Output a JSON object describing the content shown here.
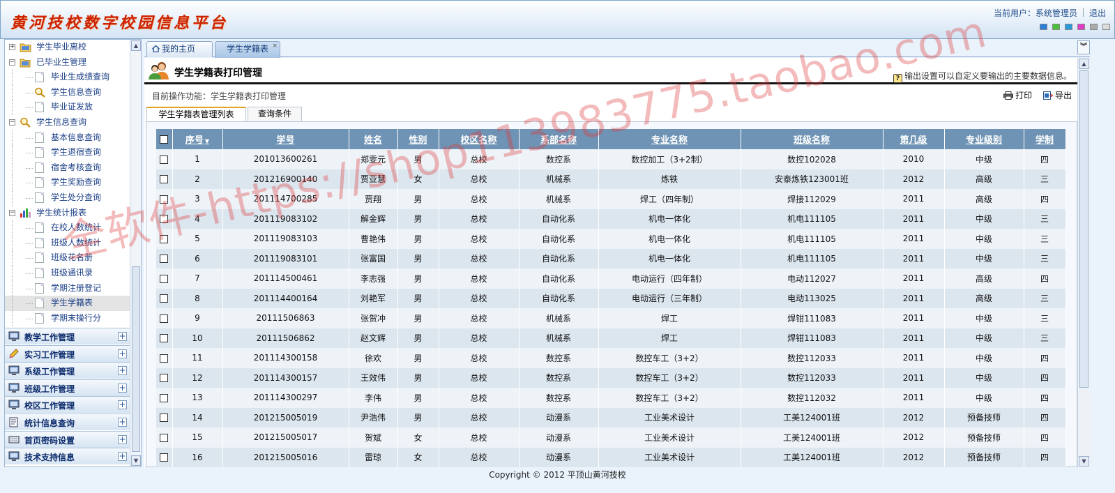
{
  "header": {
    "logo_text": "黄河技校数字校园信息平台",
    "current_user_label": "当前用户：系统管理员",
    "logout_label": "退出",
    "skin_colors": [
      "#2a7fd8",
      "#48c039",
      "#2a9ad8",
      "#e03cc8",
      "#aaaaaa",
      "#dddddd"
    ]
  },
  "sidebar": {
    "tree": [
      {
        "label": "学生毕业离校",
        "level": 1,
        "toggle": "+",
        "icon": "folder-icon"
      },
      {
        "label": "已毕业生管理",
        "level": 1,
        "toggle": "−",
        "icon": "folder-open-icon"
      },
      {
        "label": "毕业生成绩查询",
        "level": 2,
        "icon": "page-icon"
      },
      {
        "label": "学生信息查询",
        "level": 2,
        "icon": "magnifier-icon"
      },
      {
        "label": "毕业证发放",
        "level": 2,
        "icon": "page-icon"
      },
      {
        "label": "学生信息查询",
        "level": 1,
        "toggle": "−",
        "icon": "magnifier-icon"
      },
      {
        "label": "基本信息查询",
        "level": 2,
        "icon": "page-icon"
      },
      {
        "label": "学生退宿查询",
        "level": 2,
        "icon": "page-icon"
      },
      {
        "label": "宿舍考核查询",
        "level": 2,
        "icon": "page-icon"
      },
      {
        "label": "学生奖励查询",
        "level": 2,
        "icon": "page-icon"
      },
      {
        "label": "学生处分查询",
        "level": 2,
        "icon": "page-icon"
      },
      {
        "label": "学生统计报表",
        "level": 1,
        "toggle": "−",
        "icon": "bar-chart-icon"
      },
      {
        "label": "在校人数统计",
        "level": 2,
        "icon": "page-icon"
      },
      {
        "label": "班级人数统计",
        "level": 2,
        "icon": "page-icon"
      },
      {
        "label": "班级花名册",
        "level": 2,
        "icon": "page-icon"
      },
      {
        "label": "班级通讯录",
        "level": 2,
        "icon": "page-icon"
      },
      {
        "label": "学期注册登记",
        "level": 2,
        "icon": "page-icon"
      },
      {
        "label": "学生学籍表",
        "level": 2,
        "icon": "page-icon",
        "selected": true
      },
      {
        "label": "学期末操行分",
        "level": 2,
        "icon": "page-icon"
      }
    ],
    "sections": [
      {
        "label": "教学工作管理",
        "icon": "monitor-icon"
      },
      {
        "label": "实习工作管理",
        "icon": "pencil-icon"
      },
      {
        "label": "系级工作管理",
        "icon": "monitor-icon"
      },
      {
        "label": "班级工作管理",
        "icon": "monitor-icon"
      },
      {
        "label": "校区工作管理",
        "icon": "monitor-icon"
      },
      {
        "label": "统计信息查询",
        "icon": "document-icon"
      },
      {
        "label": "首页密码设置",
        "icon": "keyboard-icon"
      },
      {
        "label": "技术支持信息",
        "icon": "monitor-icon"
      }
    ],
    "expand_symbol": "+"
  },
  "tabs": [
    {
      "label": "我的主页"
    },
    {
      "label": "学生学籍表",
      "close": "×"
    }
  ],
  "tabs_scroll_symbol": "︾",
  "page": {
    "title": "学生学籍表打印管理",
    "tip": "输出设置可以自定义要输出的主要数据信息。",
    "tip_icon": "?",
    "crumb": "目前操作功能：学生学籍表打印管理",
    "print_label": "打印",
    "export_label": "导出",
    "subtabs": [
      "学生学籍表管理列表",
      "查询条件"
    ]
  },
  "table": {
    "columns": [
      "序号",
      "学号",
      "姓名",
      "性别",
      "校区名称",
      "系部名称",
      "专业名称",
      "班级名称",
      "第几级",
      "专业级别",
      "学制"
    ],
    "sort_indicator": "▼",
    "rows": [
      [
        "1",
        "201013600261",
        "郑雯元",
        "男",
        "总校",
        "数控系",
        "数控加工（3+2制）",
        "数控102028",
        "2010",
        "中级",
        "四"
      ],
      [
        "2",
        "201216900140",
        "贾亚慧",
        "女",
        "总校",
        "机械系",
        "炼铁",
        "安泰炼铁123001班",
        "2012",
        "高级",
        "三"
      ],
      [
        "3",
        "201114700285",
        "贾翔",
        "男",
        "总校",
        "机械系",
        "焊工（四年制）",
        "焊接112029",
        "2011",
        "高级",
        "四"
      ],
      [
        "4",
        "201119083102",
        "解金辉",
        "男",
        "总校",
        "自动化系",
        "机电一体化",
        "机电111105",
        "2011",
        "中级",
        "三"
      ],
      [
        "5",
        "201119083103",
        "曹艳伟",
        "男",
        "总校",
        "自动化系",
        "机电一体化",
        "机电111105",
        "2011",
        "中级",
        "三"
      ],
      [
        "6",
        "201119083101",
        "张富国",
        "男",
        "总校",
        "自动化系",
        "机电一体化",
        "机电111105",
        "2011",
        "中级",
        "三"
      ],
      [
        "7",
        "201114500461",
        "李志强",
        "男",
        "总校",
        "自动化系",
        "电动运行（四年制）",
        "电动112027",
        "2011",
        "高级",
        "四"
      ],
      [
        "8",
        "201114400164",
        "刘艳军",
        "男",
        "总校",
        "自动化系",
        "电动运行（三年制）",
        "电动113025",
        "2011",
        "高级",
        "三"
      ],
      [
        "9",
        "20111506863",
        "张贺冲",
        "男",
        "总校",
        "机械系",
        "焊工",
        "焊钳111083",
        "2011",
        "中级",
        "三"
      ],
      [
        "10",
        "20111506862",
        "赵文辉",
        "男",
        "总校",
        "机械系",
        "焊工",
        "焊钳111083",
        "2011",
        "中级",
        "三"
      ],
      [
        "11",
        "201114300158",
        "徐欢",
        "男",
        "总校",
        "数控系",
        "数控车工（3+2）",
        "数控112033",
        "2011",
        "中级",
        "四"
      ],
      [
        "12",
        "201114300157",
        "王效伟",
        "男",
        "总校",
        "数控系",
        "数控车工（3+2）",
        "数控112033",
        "2011",
        "中级",
        "四"
      ],
      [
        "13",
        "201114300297",
        "李伟",
        "男",
        "总校",
        "数控系",
        "数控车工（3+2）",
        "数控112032",
        "2011",
        "中级",
        "四"
      ],
      [
        "14",
        "201215005019",
        "尹浩伟",
        "男",
        "总校",
        "动漫系",
        "工业美术设计",
        "工美124001班",
        "2012",
        "预备技师",
        "四"
      ],
      [
        "15",
        "201215005017",
        "贺斌",
        "女",
        "总校",
        "动漫系",
        "工业美术设计",
        "工美124001班",
        "2012",
        "预备技师",
        "四"
      ],
      [
        "16",
        "201215005016",
        "雷琼",
        "女",
        "总校",
        "动漫系",
        "工业美术设计",
        "工美124001班",
        "2012",
        "预备技师",
        "四"
      ]
    ]
  },
  "footer": {
    "copyright": "Copyright © 2012 平顶山黄河技校"
  },
  "watermark": "全软件-https://shop113983775.taobao.com"
}
